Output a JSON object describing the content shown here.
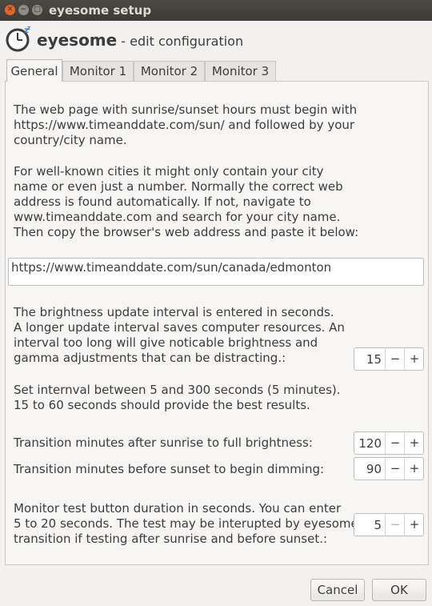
{
  "window": {
    "title": "eyesome setup"
  },
  "header": {
    "app_name": "eyesome",
    "subtitle": " - edit configuration"
  },
  "tabs": [
    {
      "label": "General",
      "active": true
    },
    {
      "label": "Monitor 1",
      "active": false
    },
    {
      "label": "Monitor 2",
      "active": false
    },
    {
      "label": "Monitor 3",
      "active": false
    }
  ],
  "general": {
    "sun_intro": "The web page with sunrise/sunset hours must begin with\nhttps://www.timeanddate.com/sun/ and followed by your\ncountry/city name.",
    "sun_help": "For well-known cities it might only contain your city\nname or even just a number.  Normally the correct web\naddress is found automatically.  If not, navigate to\nwww.timeanddate.com and search for your city name.\nThen copy the browser's web address and paste it below:",
    "url_value": "https://www.timeanddate.com/sun/canada/edmonton",
    "interval_text": "The brightness update interval is entered in seconds.\nA longer update interval saves computer resources.  An\ninterval too long will give noticable brightness and\ngamma adjustments that can be distracting.:",
    "interval_value": "15",
    "interval_hint": "Set internval between 5 and 300 seconds (5 minutes).\n15 to 60 seconds should provide the best results.",
    "sunrise_label": "Transition minutes after sunrise to full brightness:",
    "sunrise_value": "120",
    "sunset_label": "Transition minutes before sunset to begin dimming:",
    "sunset_value": "90",
    "test_text": "Monitor test button duration in seconds. You can enter\n5 to 20 seconds. The test may be interupted by eyesome\ntransition if testing after sunrise and before sunset.:",
    "test_value": "5",
    "minus_glyph": "−",
    "plus_glyph": "+"
  },
  "buttons": {
    "cancel": "Cancel",
    "ok": "OK"
  },
  "colors": {
    "close_button": "#e8622a",
    "titlebar": "#3c3b37",
    "window_bg": "#f2f1f0"
  }
}
